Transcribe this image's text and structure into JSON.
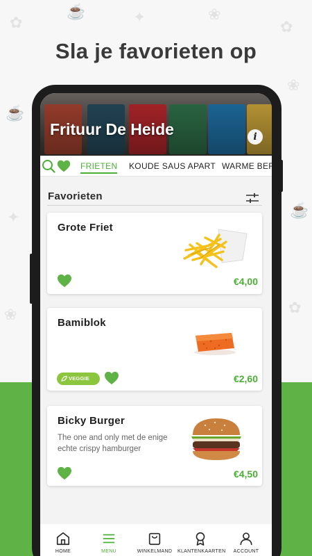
{
  "headline": "Sla je favorieten op",
  "restaurant": {
    "name": "Frituur De Heide"
  },
  "tabs": [
    {
      "label": "FRIETEN",
      "active": true
    },
    {
      "label": "KOUDE SAUS APART",
      "active": false
    },
    {
      "label": "WARME BERI",
      "active": false
    }
  ],
  "section": {
    "title": "Favorieten"
  },
  "items": [
    {
      "name": "Grote Friet",
      "description": "",
      "price": "€4,00",
      "favorite": true,
      "veggie": false
    },
    {
      "name": "Bamiblok",
      "description": "",
      "price": "€2,60",
      "favorite": true,
      "veggie": true,
      "veggie_label": "VEGGIE"
    },
    {
      "name": "Bicky Burger",
      "description": "The one and only met de enige echte crispy hamburger",
      "price": "€4,50",
      "favorite": true,
      "veggie": false
    }
  ],
  "bottom_nav": [
    {
      "label": "HOME",
      "icon": "home-icon",
      "active": false
    },
    {
      "label": "MENU",
      "icon": "menu-icon",
      "active": true
    },
    {
      "label": "WINKELMAND",
      "icon": "shopping-bag-icon",
      "active": false
    },
    {
      "label": "KLANTENKAARTEN",
      "icon": "award-icon",
      "active": false
    },
    {
      "label": "ACCOUNT",
      "icon": "user-icon",
      "active": false
    }
  ],
  "colors": {
    "accent_green": "#4caf35",
    "veggie_green": "#8cc63f",
    "background_green": "#5fb246",
    "favorite_heart": "#5fb246"
  }
}
